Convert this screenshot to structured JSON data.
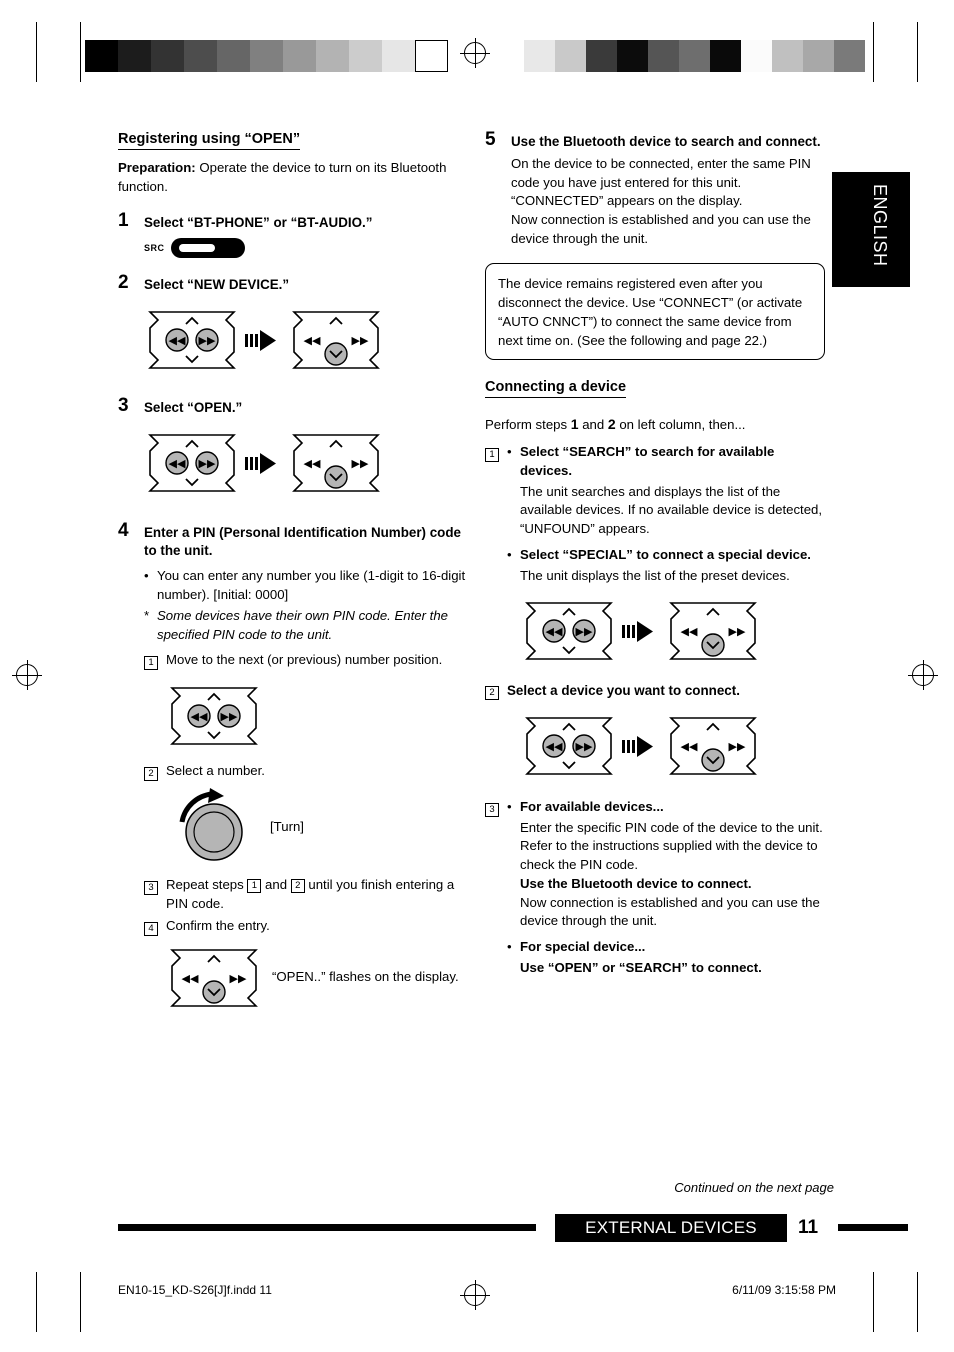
{
  "document": {
    "language_tab": "ENGLISH",
    "footer": {
      "continued": "Continued on the next page",
      "section": "EXTERNAL DEVICES",
      "page_number": "11",
      "filename": "EN10-15_KD-S26[J]f.indd   11",
      "timestamp": "6/11/09   3:15:58 PM"
    }
  },
  "left": {
    "heading": "Registering using “OPEN”",
    "preparation_label": "Preparation:",
    "preparation_text": " Operate the device to turn on its Bluetooth function.",
    "step1": {
      "num": "1",
      "title": "Select “BT-PHONE” or “BT-AUDIO.”",
      "src_label": "SRC"
    },
    "step2": {
      "num": "2",
      "title": "Select “NEW DEVICE.”"
    },
    "step3": {
      "num": "3",
      "title": "Select “OPEN.”"
    },
    "step4": {
      "num": "4",
      "title": "Enter a PIN (Personal Identification Number) code to the unit.",
      "bullet1": "You can enter any number you like (1-digit to 16-digit number). [Initial: 0000]",
      "note_star": "Some devices have their own PIN code. Enter the specified PIN code to the unit.",
      "sub1_mark": "1",
      "sub1": "Move to the next (or previous) number position.",
      "sub2_mark": "2",
      "sub2": "Select a number.",
      "turn_label": "[Turn]",
      "sub3_mark": "3",
      "sub3_a": "Repeat steps ",
      "sub3_m1": "1",
      "sub3_b": " and ",
      "sub3_m2": "2",
      "sub3_c": " until you finish entering a PIN code.",
      "sub4_mark": "4",
      "sub4": "Confirm the entry.",
      "flash_note": "“OPEN..” flashes on the display."
    }
  },
  "right": {
    "step5": {
      "num": "5",
      "title": "Use the Bluetooth device to search and connect.",
      "body": "On the device to be connected, enter the same PIN code you have just entered for this unit. “CONNECTED” appears on the display.\nNow connection is established and you can use the device through the unit."
    },
    "notebox": "The device remains registered even after you disconnect the device. Use “CONNECT” (or activate “AUTO CNNCT”) to connect the same device from next time on. (See the following and page 22.)",
    "heading2": "Connecting a device",
    "perform_a": "Perform steps ",
    "perform_1": "1",
    "perform_b": " and ",
    "perform_2": "2",
    "perform_c": " on left column, then...",
    "item1": {
      "mark": "1",
      "b1_title": "Select “SEARCH” to search for available devices.",
      "b1_body": "The unit searches and displays the list of the available devices. If no available device is detected, “UNFOUND” appears.",
      "b2_title": "Select “SPECIAL” to connect a special device.",
      "b2_body": "The unit displays the list of the preset devices."
    },
    "item2": {
      "mark": "2",
      "title": "Select a device you want to connect."
    },
    "item3": {
      "mark": "3",
      "b1_title": "For available devices...",
      "b1_body": "Enter the specific PIN code of the device to the unit.\nRefer to the instructions supplied with the device to check the PIN code.",
      "b1_bold": "Use the Bluetooth device to connect.",
      "b1_body2": "Now connection is established and you can use the device through the unit.",
      "b2_title": "For special device...",
      "b2_bold": "Use “OPEN” or “SEARCH” to connect."
    }
  }
}
